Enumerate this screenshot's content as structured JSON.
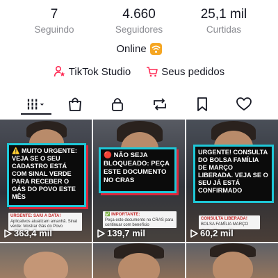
{
  "stats": [
    {
      "value": "7",
      "label": "Seguindo"
    },
    {
      "value": "4.660",
      "label": "Seguidores"
    },
    {
      "value": "25,1 mil",
      "label": "Curtidas"
    }
  ],
  "status": {
    "text": "Online",
    "icon": "wifi-icon"
  },
  "links": {
    "studio": {
      "label": "TikTok Studio",
      "icon": "person-star-icon"
    },
    "orders": {
      "label": "Seus pedidos",
      "icon": "cart-icon"
    }
  },
  "tabs": [
    {
      "icon": "grid-dropdown-icon",
      "active": true
    },
    {
      "icon": "shopping-bag-icon"
    },
    {
      "icon": "lock-icon"
    },
    {
      "icon": "repost-icon"
    },
    {
      "icon": "bookmark-icon"
    },
    {
      "icon": "heart-icon"
    }
  ],
  "videos": [
    {
      "headline": "⚠️ MUITO URGENTE: VEJA SE O SEU CADASTRO ESTÁ COM SINAL VERDE PARA RECEBER O GÁS DO POVO ESTE MÊS",
      "sub_title": "URGENTE: SAIU A DATA!",
      "sub_text": "Aplicativos atualizam amanhã. Sinal verde: Mostrar Gás do Povo",
      "views": "363,4 mil"
    },
    {
      "headline": "🔴 NÃO SEJA BLOQUEADO: PEÇA ESTE DOCUMENTO NO CRAS",
      "sub_title": "✅ IMPORTANTE:",
      "sub_text": "Peça este documento no CRAS para continuar com benefício",
      "views": "139,7 mil"
    },
    {
      "headline": "URGENTE! CONSULTA DO BOLSA FAMÍLIA DE MARÇO LIBERADA. VEJA SE O SEU JÁ ESTÁ CONFIRMADO",
      "sub_title": "CONSULTA LIBERADA!",
      "sub_text": "BOLSA FAMÍLIA MARÇO",
      "views": "60,2 mil"
    }
  ],
  "colors": {
    "accent_border": "#1ec8d8",
    "accent_shadow": "#e0263a",
    "studio_pink": "#fe2c55",
    "wifi_orange": "#f5a623"
  }
}
